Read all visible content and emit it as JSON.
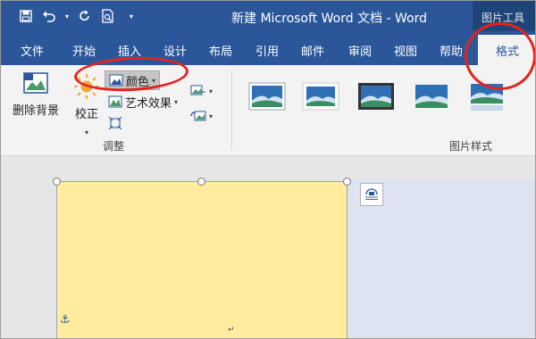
{
  "qat": {
    "save_icon": "save-icon",
    "undo_icon": "undo-icon",
    "redo_icon": "redo-icon",
    "preview_icon": "print-preview-icon",
    "customize_icon": "customize-qat-icon"
  },
  "window": {
    "title": "新建 Microsoft Word 文档  -  Word",
    "tools_label": "图片工具"
  },
  "tabs": [
    {
      "label": "文件"
    },
    {
      "label": "开始"
    },
    {
      "label": "插入"
    },
    {
      "label": "设计"
    },
    {
      "label": "布局"
    },
    {
      "label": "引用"
    },
    {
      "label": "邮件"
    },
    {
      "label": "审阅"
    },
    {
      "label": "视图"
    },
    {
      "label": "帮助"
    },
    {
      "label": "格式",
      "active": true
    }
  ],
  "ribbon": {
    "remove_bg": "删除背景",
    "correct": "校正",
    "color": "颜色",
    "artistic": "艺术效果",
    "group_adjust": "调整",
    "group_styles": "图片样式"
  },
  "colors": {
    "accent": "#2b579a",
    "picture_fill": "#ffec9f",
    "annotation": "#e4231f"
  }
}
